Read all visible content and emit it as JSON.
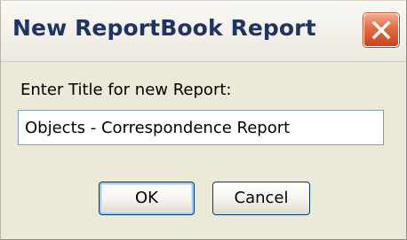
{
  "window": {
    "title": "New ReportBook Report",
    "close_icon": "close-icon"
  },
  "form": {
    "prompt_label": "Enter Title for new Report:",
    "title_value": "Objects - Correspondence Report"
  },
  "buttons": {
    "ok_label": "OK",
    "cancel_label": "Cancel"
  },
  "colors": {
    "title_text": "#1f3461",
    "close_button": "#e46a43",
    "dialog_background": "#ece9d8",
    "input_border": "#7f9db9",
    "button_border": "#003c74"
  }
}
